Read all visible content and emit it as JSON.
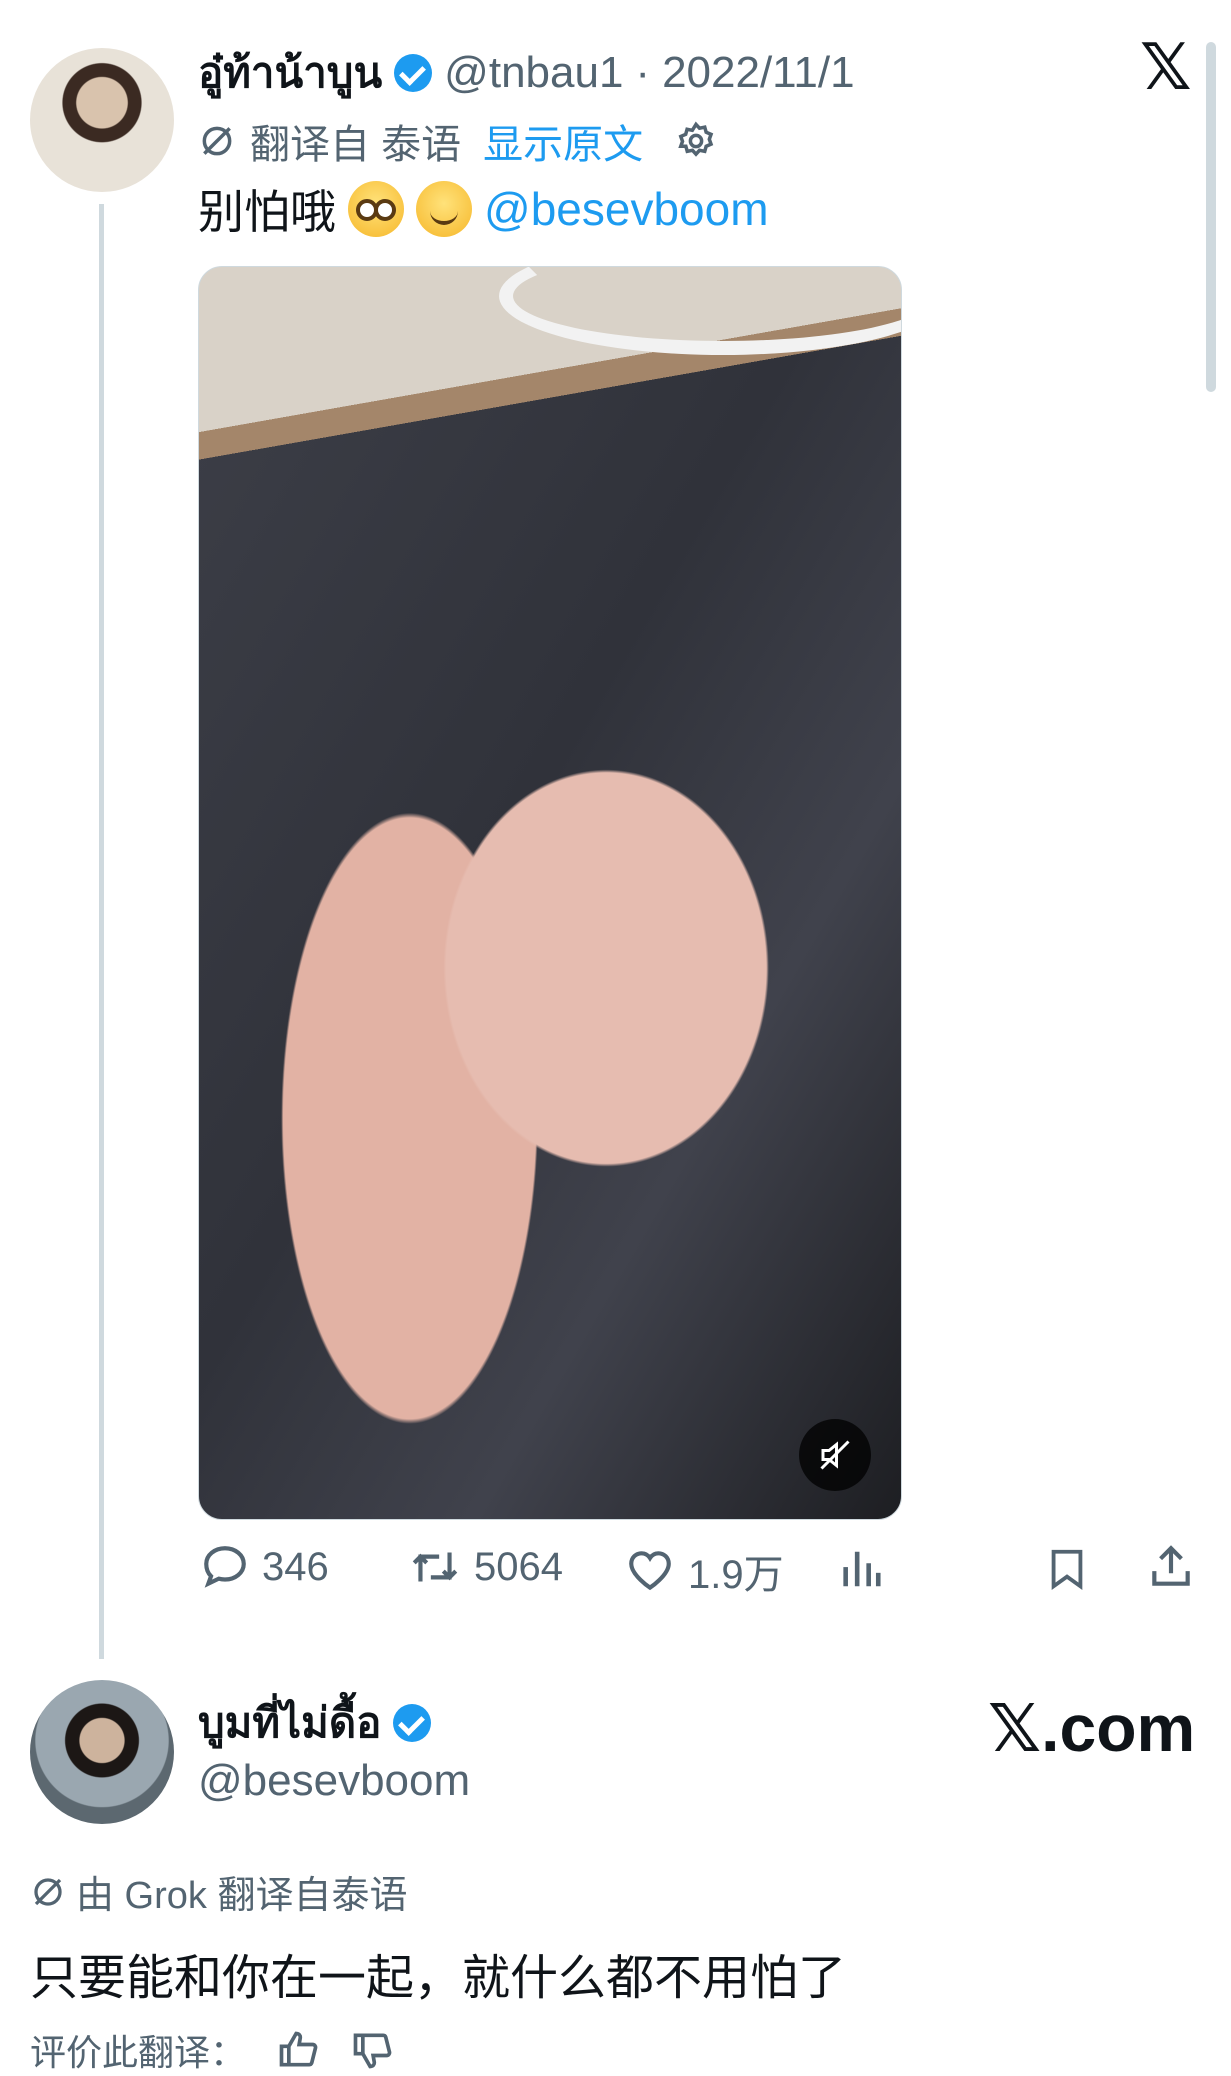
{
  "tweet1": {
    "display_name": "อู๋ท้าน้าบูน",
    "handle": "@tnbau1",
    "separator": "·",
    "date": "2022/11/1",
    "translate_label": "翻译自 泰语",
    "show_original": "显示原文",
    "text": "别怕哦",
    "mention": "@besevboom",
    "actions": {
      "replies": "346",
      "retweets": "5064",
      "likes": "1.9万"
    }
  },
  "tweet2": {
    "display_name": "บูมที่ไม่ดื้อ",
    "handle": "@besevboom",
    "brand": "𝕏.com",
    "translate_label": "由 Grok 翻译自泰语",
    "text": "只要能和你在一起，就什么都不用怕了",
    "rate_label": "评价此翻译："
  },
  "icons": {
    "close": "𝕏",
    "verified": "verified-badge-icon"
  },
  "colors": {
    "accent": "#1d9bf0",
    "secondary_text": "#536471",
    "primary_text": "#0f1419"
  }
}
